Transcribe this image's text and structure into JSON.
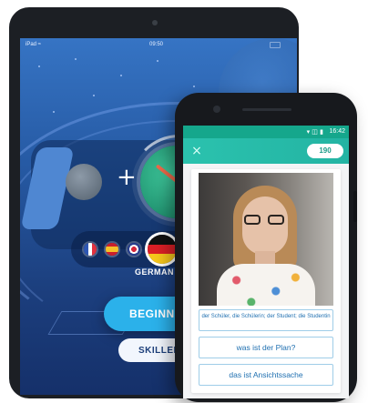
{
  "tablet": {
    "status_bar": {
      "carrier": "iPad ≈",
      "time": "09:50"
    },
    "languages": [
      {
        "name": "french-flag"
      },
      {
        "name": "spanish-flag"
      },
      {
        "name": "english-flag"
      },
      {
        "name": "german-flag",
        "selected": true
      }
    ],
    "selected_language_label": "GERMAN",
    "level_primary": "BEGINNER",
    "level_secondary": "SKILLED",
    "colors": {
      "background_top": "#3674c4",
      "background_bottom": "#15306a",
      "primary_button": "#2bb1ea",
      "secondary_button": "#f2f6fd"
    }
  },
  "phone": {
    "status_bar": {
      "icons": "▾ ◫ ▮",
      "time": "16:42"
    },
    "header": {
      "close_glyph": "×",
      "score": "190"
    },
    "quiz": {
      "image": "photo-of-woman-with-glasses",
      "answers": [
        "der Schüler, die Schülerin; der Student; die Studentin",
        "was ist der Plan?",
        "das ist Ansichtssache"
      ]
    },
    "colors": {
      "header": "#2bc2ae",
      "answer_text": "#1e6fb0",
      "answer_border": "#9fcde8"
    }
  }
}
